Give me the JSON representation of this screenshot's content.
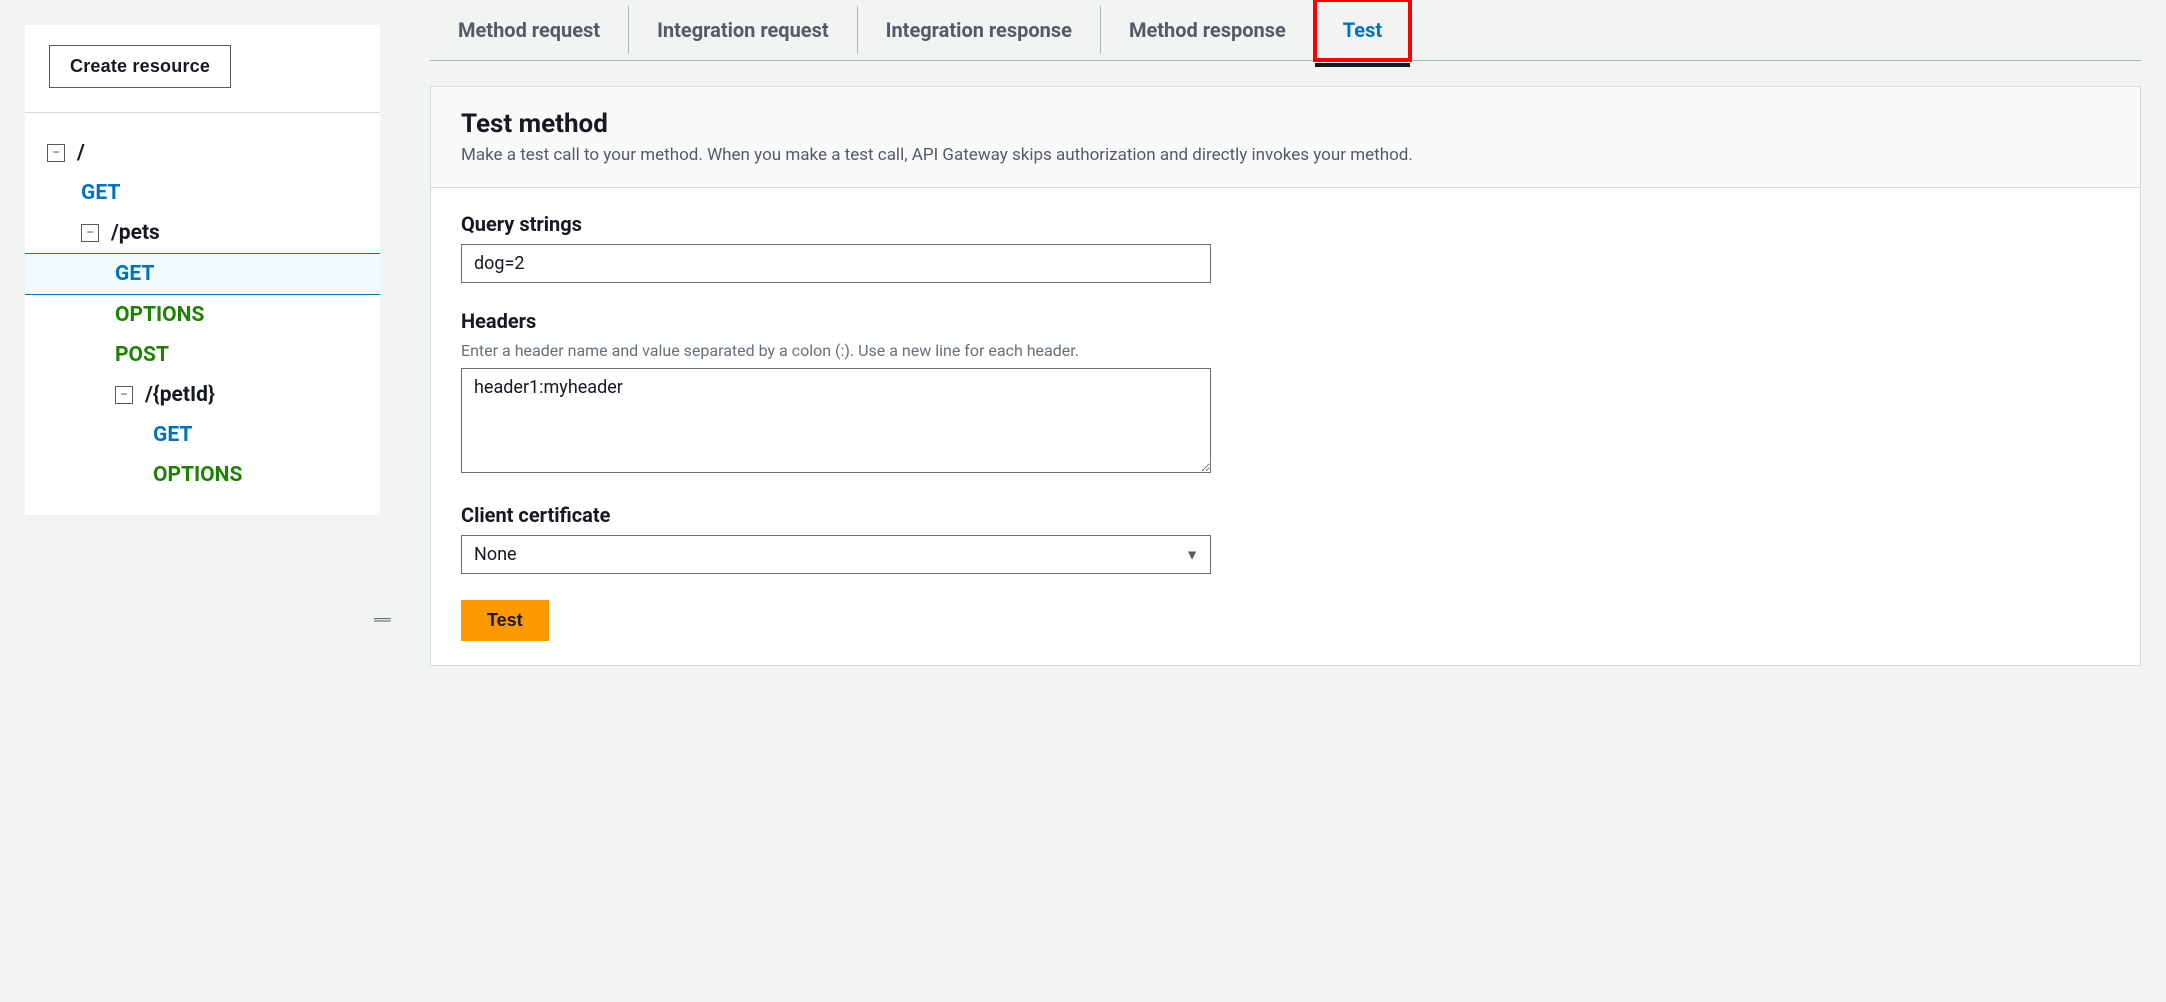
{
  "sidebar": {
    "create_resource_label": "Create resource",
    "tree": {
      "root": "/",
      "root_children": [
        {
          "method": "GET",
          "class": "method-get"
        }
      ],
      "pets": "/pets",
      "pets_children": [
        {
          "method": "GET",
          "class": "method-get",
          "selected": true
        },
        {
          "method": "OPTIONS",
          "class": "method-options"
        },
        {
          "method": "POST",
          "class": "method-post"
        }
      ],
      "petid": "/{petId}",
      "petid_children": [
        {
          "method": "GET",
          "class": "method-get"
        },
        {
          "method": "OPTIONS",
          "class": "method-options"
        }
      ]
    }
  },
  "tabs": [
    {
      "label": "Method request",
      "active": false
    },
    {
      "label": "Integration request",
      "active": false
    },
    {
      "label": "Integration response",
      "active": false
    },
    {
      "label": "Method response",
      "active": false
    },
    {
      "label": "Test",
      "active": true,
      "highlighted": true
    }
  ],
  "panel": {
    "title": "Test method",
    "description": "Make a test call to your method. When you make a test call, API Gateway skips authorization and directly invokes your method.",
    "query_strings": {
      "label": "Query strings",
      "value": "dog=2"
    },
    "headers": {
      "label": "Headers",
      "hint": "Enter a header name and value separated by a colon (:). Use a new line for each header.",
      "value": "header1:myheader"
    },
    "client_certificate": {
      "label": "Client certificate",
      "value": "None"
    },
    "test_button": "Test"
  }
}
